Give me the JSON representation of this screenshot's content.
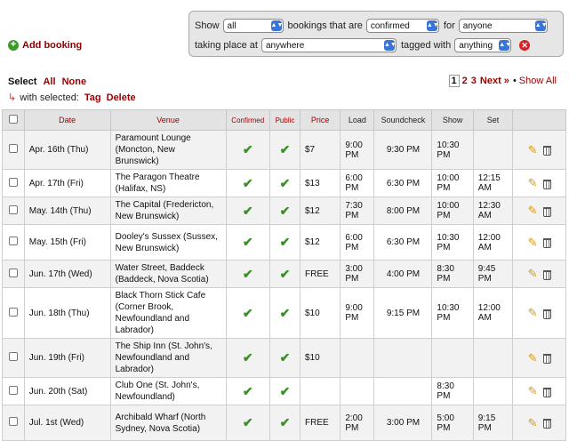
{
  "filters": {
    "show_label": "Show",
    "show_value": "all",
    "bookings_label": "bookings that are",
    "status_value": "confirmed",
    "for_label": "for",
    "for_value": "anyone",
    "taking_place_label": "taking place at",
    "place_value": "anywhere",
    "tagged_label": "tagged with",
    "tag_value": "anything"
  },
  "add_booking": "Add booking",
  "select": {
    "label": "Select",
    "all": "All",
    "none": "None"
  },
  "with_selected": {
    "label": "with selected:",
    "tag": "Tag",
    "delete": "Delete"
  },
  "pager": {
    "current": "1",
    "pages": [
      "2",
      "3"
    ],
    "next": "Next »",
    "show_all": "Show All"
  },
  "table": {
    "headers": {
      "date": "Date",
      "venue": "Venue",
      "confirmed": "Confirmed",
      "public": "Public",
      "price": "Price",
      "load": "Load",
      "soundcheck": "Soundcheck",
      "show": "Show",
      "set": "Set"
    },
    "rows": [
      {
        "date": "Apr. 16th (Thu)",
        "venue": "Paramount Lounge (Moncton, New Brunswick)",
        "confirmed": true,
        "public": true,
        "price": "$7",
        "load": "9:00 PM",
        "soundcheck": "9:30 PM",
        "show": "10:30 PM",
        "set": ""
      },
      {
        "date": "Apr. 17th (Fri)",
        "venue": "The Paragon Theatre (Halifax, NS)",
        "confirmed": true,
        "public": true,
        "price": "$13",
        "load": "6:00 PM",
        "soundcheck": "6:30 PM",
        "show": "10:00 PM",
        "set": "12:15 AM"
      },
      {
        "date": "May. 14th (Thu)",
        "venue": "The Capital (Fredericton, New Brunswick)",
        "confirmed": true,
        "public": true,
        "price": "$12",
        "load": "7:30 PM",
        "soundcheck": "8:00 PM",
        "show": "10:00 PM",
        "set": "12:30 AM"
      },
      {
        "date": "May. 15th (Fri)",
        "venue": "Dooley's Sussex (Sussex, New Brunswick)",
        "confirmed": true,
        "public": true,
        "price": "$12",
        "load": "6:00 PM",
        "soundcheck": "6:30 PM",
        "show": "10:30 PM",
        "set": "12:00 AM"
      },
      {
        "date": "Jun. 17th (Wed)",
        "venue": "Water Street, Baddeck (Baddeck, Nova Scotia)",
        "confirmed": true,
        "public": true,
        "price": "FREE",
        "load": "3:00 PM",
        "soundcheck": "4:00 PM",
        "show": "8:30 PM",
        "set": "9:45 PM"
      },
      {
        "date": "Jun. 18th (Thu)",
        "venue": "Black Thorn Stick Cafe (Corner Brook, Newfoundland and Labrador)",
        "confirmed": true,
        "public": true,
        "price": "$10",
        "load": "9:00 PM",
        "soundcheck": "9:15 PM",
        "show": "10:30 PM",
        "set": "12:00 AM"
      },
      {
        "date": "Jun. 19th (Fri)",
        "venue": "The Ship Inn (St. John's, Newfoundland and Labrador)",
        "confirmed": true,
        "public": true,
        "price": "$10",
        "load": "",
        "soundcheck": "",
        "show": "",
        "set": ""
      },
      {
        "date": "Jun. 20th (Sat)",
        "venue": "Club One (St. John's, Newfoundland)",
        "confirmed": true,
        "public": true,
        "price": "",
        "load": "",
        "soundcheck": "",
        "show": "8:30 PM",
        "set": ""
      },
      {
        "date": "Jul. 1st (Wed)",
        "venue": "Archibald Wharf (North Sydney, Nova Scotia)",
        "confirmed": true,
        "public": true,
        "price": "FREE",
        "load": "2:00 PM",
        "soundcheck": "3:00 PM",
        "show": "5:00 PM",
        "set": "9:15 PM"
      }
    ]
  },
  "icons": {
    "edit": "pencil-icon",
    "delete": "trash-icon",
    "check": "check-icon",
    "add": "plus-icon",
    "clear": "clear-filter-icon"
  },
  "colors": {
    "link": "#9b0000",
    "check": "#3a8f26",
    "header_bg": "#e3e3e3",
    "filter_bg": "#e6e6e6"
  }
}
